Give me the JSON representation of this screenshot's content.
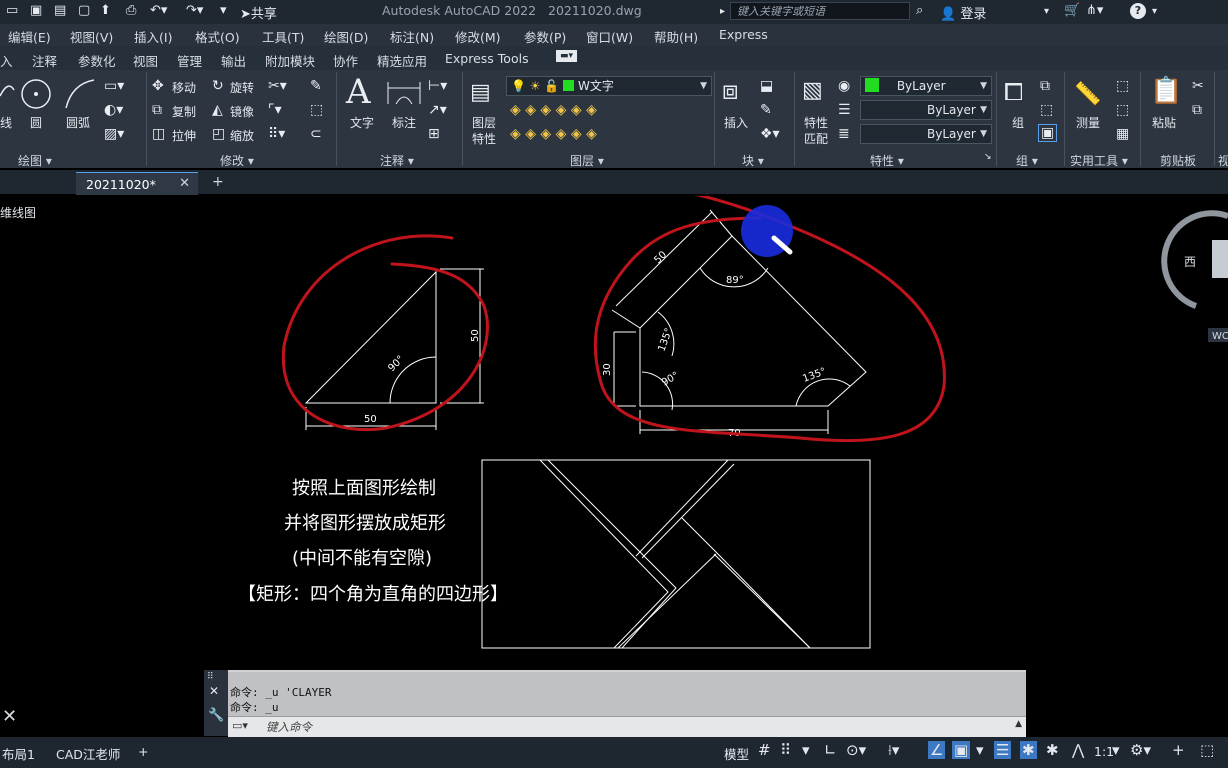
{
  "app_title": "Autodesk AutoCAD 2022",
  "file_title": "20211020.dwg",
  "share_label": "共享",
  "search_placeholder": "键入关键字或短语",
  "login_label": "登录",
  "menu": [
    "编辑(E)",
    "视图(V)",
    "插入(I)",
    "格式(O)",
    "工具(T)",
    "绘图(D)",
    "标注(N)",
    "修改(M)",
    "参数(P)",
    "窗口(W)",
    "帮助(H)",
    "Express"
  ],
  "ribbon_tabs": [
    "入",
    "注释",
    "参数化",
    "视图",
    "管理",
    "输出",
    "附加模块",
    "协作",
    "精选应用",
    "Express Tools"
  ],
  "draw_panel": {
    "line": "线",
    "circle": "圆",
    "arc": "圆弧",
    "title": "绘图"
  },
  "modify_panel": {
    "move": "移动",
    "rotate": "旋转",
    "copy": "复制",
    "mirror": "镜像",
    "stretch": "拉伸",
    "scale": "缩放",
    "title": "修改"
  },
  "annotate_panel": {
    "text": "文字",
    "dim": "标注",
    "title": "注释"
  },
  "layer_panel": {
    "props_line1": "图层",
    "props_line2": "特性",
    "current_layer": "W文字",
    "title": "图层"
  },
  "block_panel": {
    "insert": "插入",
    "title": "块"
  },
  "props_panel": {
    "match_line1": "特性",
    "match_line2": "匹配",
    "color": "ByLayer",
    "linetype": "ByLayer",
    "lineweight": "ByLayer",
    "title": "特性"
  },
  "group_panel": {
    "group": "组",
    "title": "组"
  },
  "util_panel": {
    "measure": "测量",
    "title": "实用工具"
  },
  "clip_panel": {
    "paste": "粘贴",
    "title": "剪贴板"
  },
  "clip_cut": "视",
  "doc_tab": "20211020*",
  "view_label": "维线图",
  "viewcube_west": "西",
  "wcs_label": "WC",
  "drawing": {
    "tri_dim_bottom": "50",
    "tri_dim_right": "50",
    "tri_angle": "90°",
    "pent_dim_top": "50",
    "pent_dim_left": "30",
    "pent_dim_bottom": "70",
    "pent_angle_top": "89°",
    "pent_angle_upper_left": "135°",
    "pent_angle_lower_left": "90°",
    "pent_angle_right": "135°"
  },
  "instructions": [
    "按照上面图形绘制",
    "并将图形摆放成矩形",
    "(中间不能有空隙)",
    "【矩形：四个角为直角的四边形】"
  ],
  "command_history": [
    "命令: _u  'CLAYER",
    "命令: _u"
  ],
  "command_placeholder": "键入命令",
  "layout_tabs": [
    "布局1",
    "CAD江老师"
  ],
  "status": {
    "model": "模型",
    "scale": "1:1"
  },
  "accent_colors": {
    "markup_red": "#c0141c",
    "cursor_blue": "#1a2ce0",
    "layer_green": "#22dd22"
  }
}
